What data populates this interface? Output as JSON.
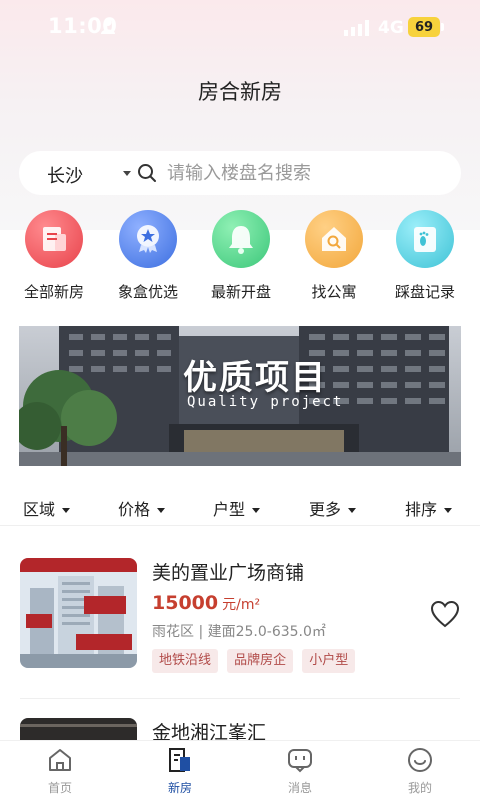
{
  "status_bar": {
    "time": "11:00",
    "network": "4G",
    "battery": "69"
  },
  "header": {
    "title": "房合新房"
  },
  "search": {
    "city": "长沙",
    "placeholder": "请输入楼盘名搜索"
  },
  "quick_nav": [
    {
      "label": "全部新房",
      "icon": "building-doc-icon",
      "color": "#e8434b"
    },
    {
      "label": "象盒优选",
      "icon": "star-medal-icon",
      "color": "#3d6fe0"
    },
    {
      "label": "最新开盘",
      "icon": "bell-icon",
      "color": "#3cc77a"
    },
    {
      "label": "找公寓",
      "icon": "search-house-icon",
      "color": "#f2a73b"
    },
    {
      "label": "踩盘记录",
      "icon": "footprint-icon",
      "color": "#3fc3d6"
    }
  ],
  "banner": {
    "title": "优质项目",
    "subtitle": "Quality project"
  },
  "filters": [
    {
      "label": "区域"
    },
    {
      "label": "价格"
    },
    {
      "label": "户型"
    },
    {
      "label": "更多"
    },
    {
      "label": "排序"
    }
  ],
  "listings": [
    {
      "name": "美的置业广场商铺",
      "price": "15000",
      "price_unit": "元/m²",
      "meta": "雨花区 | 建面25.0-635.0㎡",
      "tags": [
        "地铁沿线",
        "品牌房企",
        "小户型"
      ]
    },
    {
      "name": "金地湘江峯汇"
    }
  ],
  "tab_bar": {
    "tabs": [
      {
        "label": "首页",
        "icon": "home-icon"
      },
      {
        "label": "新房",
        "icon": "building-icon",
        "active": true
      },
      {
        "label": "消息",
        "icon": "message-icon"
      },
      {
        "label": "我的",
        "icon": "smile-icon"
      }
    ]
  },
  "colors": {
    "accent": "#1f4fa3",
    "price": "#c63f2f",
    "tag_bg": "#f7e9e9",
    "tag_text": "#b14a48"
  }
}
